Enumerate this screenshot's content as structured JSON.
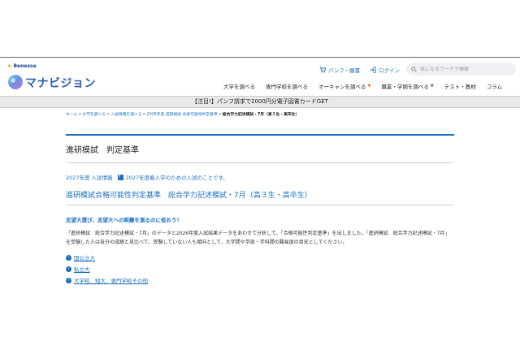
{
  "brand": {
    "benesse_mark": "★",
    "benesse": "Benesse",
    "name": "マナビジョン"
  },
  "header": {
    "pamphlet_label": "パンフ・願書",
    "login_label": "ログイン",
    "search_placeholder": "気になるワードで検索"
  },
  "nav": {
    "items": [
      {
        "label": "大学を調べる"
      },
      {
        "label": "専門学校を調べる"
      },
      {
        "label": "オーキャンを調べる"
      },
      {
        "label": "職業・学問を調べる"
      },
      {
        "label": "テスト・教材"
      },
      {
        "label": "コラム"
      }
    ]
  },
  "banner": {
    "text": "【注目!】パンフ請求で2000円分電子図書カードGET"
  },
  "breadcrumb": {
    "items": [
      "ホーム",
      "大学を調べる",
      "入試情報を調べる",
      "2026年度 進研模試 合格可能性判定基準"
    ],
    "current": "総合学力記述模試・7月（高３生・高卒生）"
  },
  "page": {
    "title": "進研模試　判定基準",
    "meta_year": "2027年度 入試情報",
    "meta_badge": "？",
    "meta_note": "2027年度春入学のための入試のことです。",
    "subtitle": "進研模試合格可能性判定基準　総合学力記述模試・7月（高３生・高卒生）",
    "lead": "志望大選び、志望大への距離を測るのに役おう！",
    "body": "「進研模試　総合学力記述模試・7月」のデータと2026年度入試結果データをあわせて分析して、「合格可能性判定基準」を出しました。「進研模試　総合学力記述模試・7月」を受験した人は自分の成績と見比べて、受験していない人も傾向として、大学間や学部・学科間の難易度の目安としてください。",
    "links": [
      {
        "label": "国公立大"
      },
      {
        "label": "私立大"
      },
      {
        "label": "大学校、短大、専門学校その他"
      }
    ]
  },
  "colors": {
    "accent": "#1a6fc4",
    "banner_bg": "#e9e9e9"
  }
}
